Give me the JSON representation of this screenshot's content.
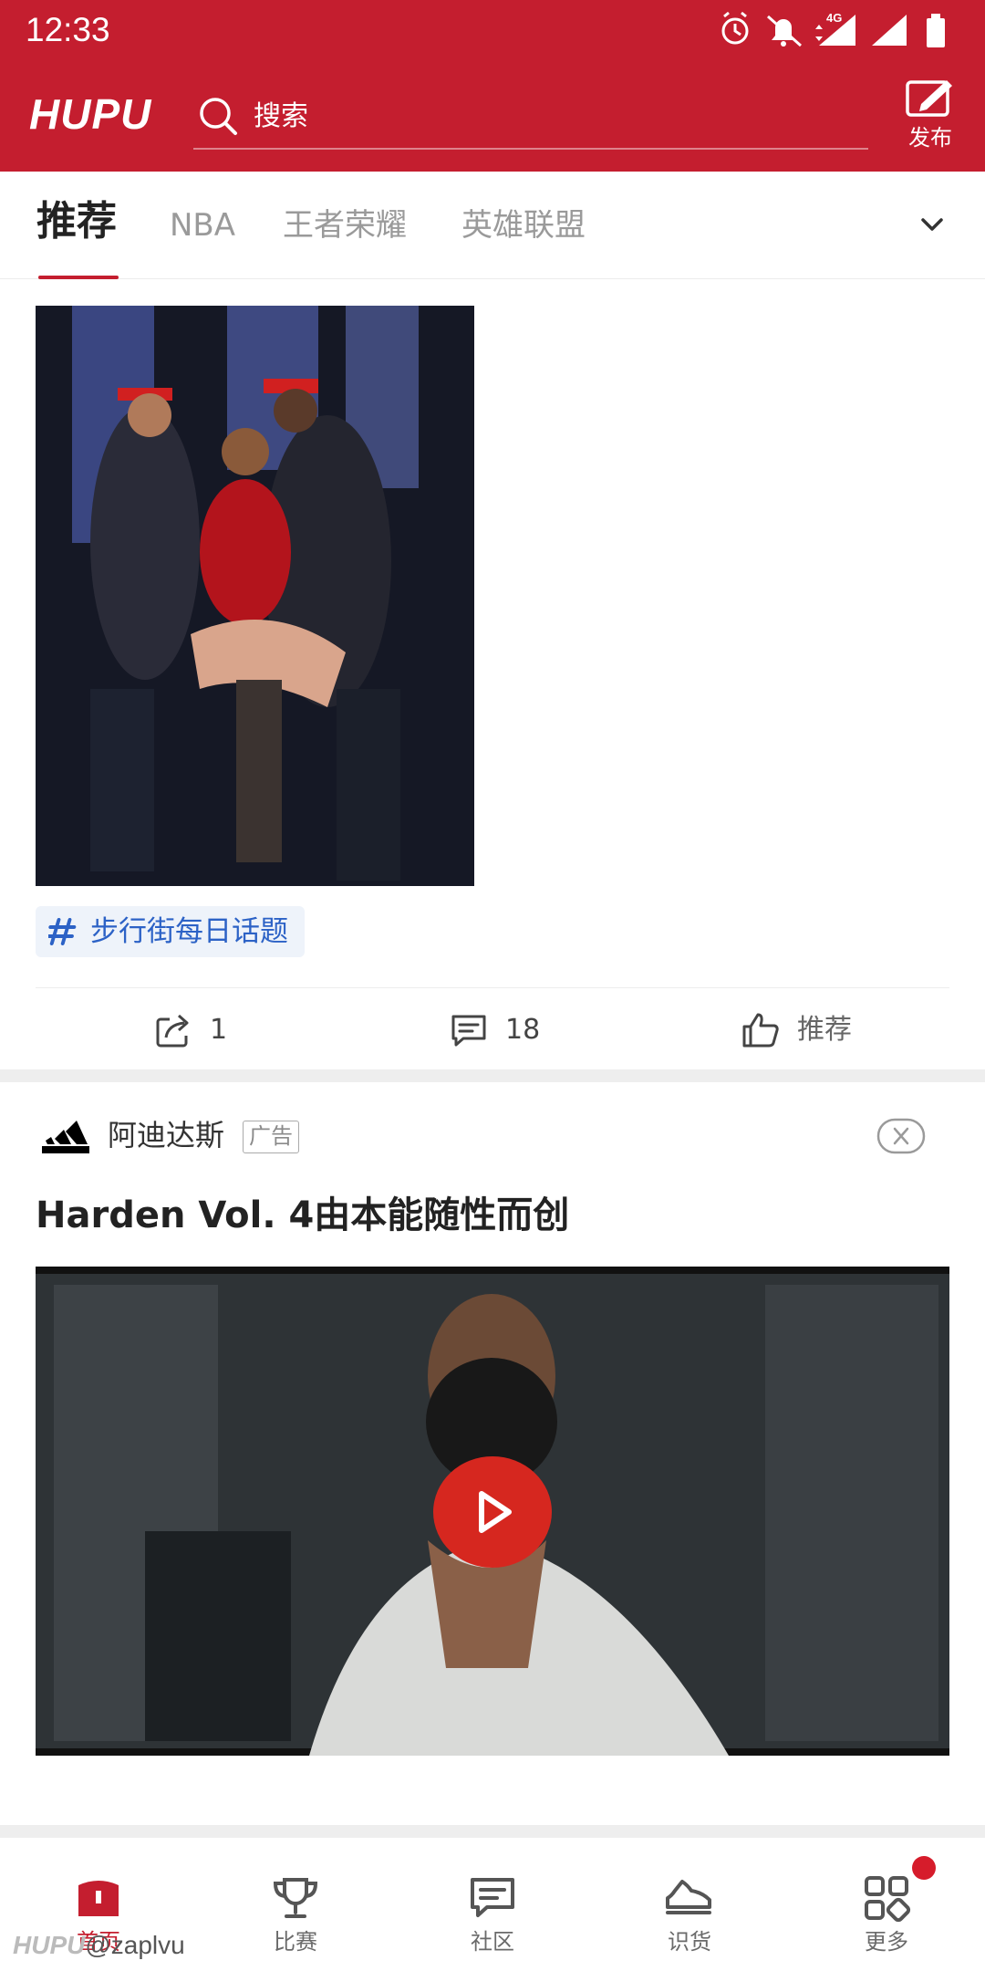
{
  "status_bar": {
    "time": "12:33",
    "network": "4G"
  },
  "header": {
    "logo": "HUPU",
    "search_placeholder": "搜索",
    "publish_label": "发布"
  },
  "tabs": [
    {
      "label": "推荐",
      "active": true
    },
    {
      "label": "NBA",
      "active": false
    },
    {
      "label": "王者荣耀",
      "active": false
    },
    {
      "label": "英雄联盟",
      "active": false
    }
  ],
  "post": {
    "topic_tag": "步行街每日话题",
    "share_count": "1",
    "comment_count": "18",
    "recommend_label": "推荐"
  },
  "ad": {
    "brand": "阿迪达斯",
    "badge": "广告",
    "title": "Harden Vol. 4由本能随性而创"
  },
  "bottom_nav": [
    {
      "label": "首页",
      "icon": "home-icon",
      "active": true
    },
    {
      "label": "比赛",
      "icon": "trophy-icon",
      "active": false
    },
    {
      "label": "社区",
      "icon": "community-icon",
      "active": false
    },
    {
      "label": "识货",
      "icon": "sneaker-icon",
      "active": false
    },
    {
      "label": "更多",
      "icon": "grid-icon",
      "active": false,
      "has_badge": true
    }
  ],
  "watermark": {
    "logo": "HUPU",
    "user": "@zaplvu"
  },
  "colors": {
    "brand_red": "#c41e2f",
    "tag_blue": "#2c62c6",
    "inactive_tab": "#9a9a9a"
  }
}
